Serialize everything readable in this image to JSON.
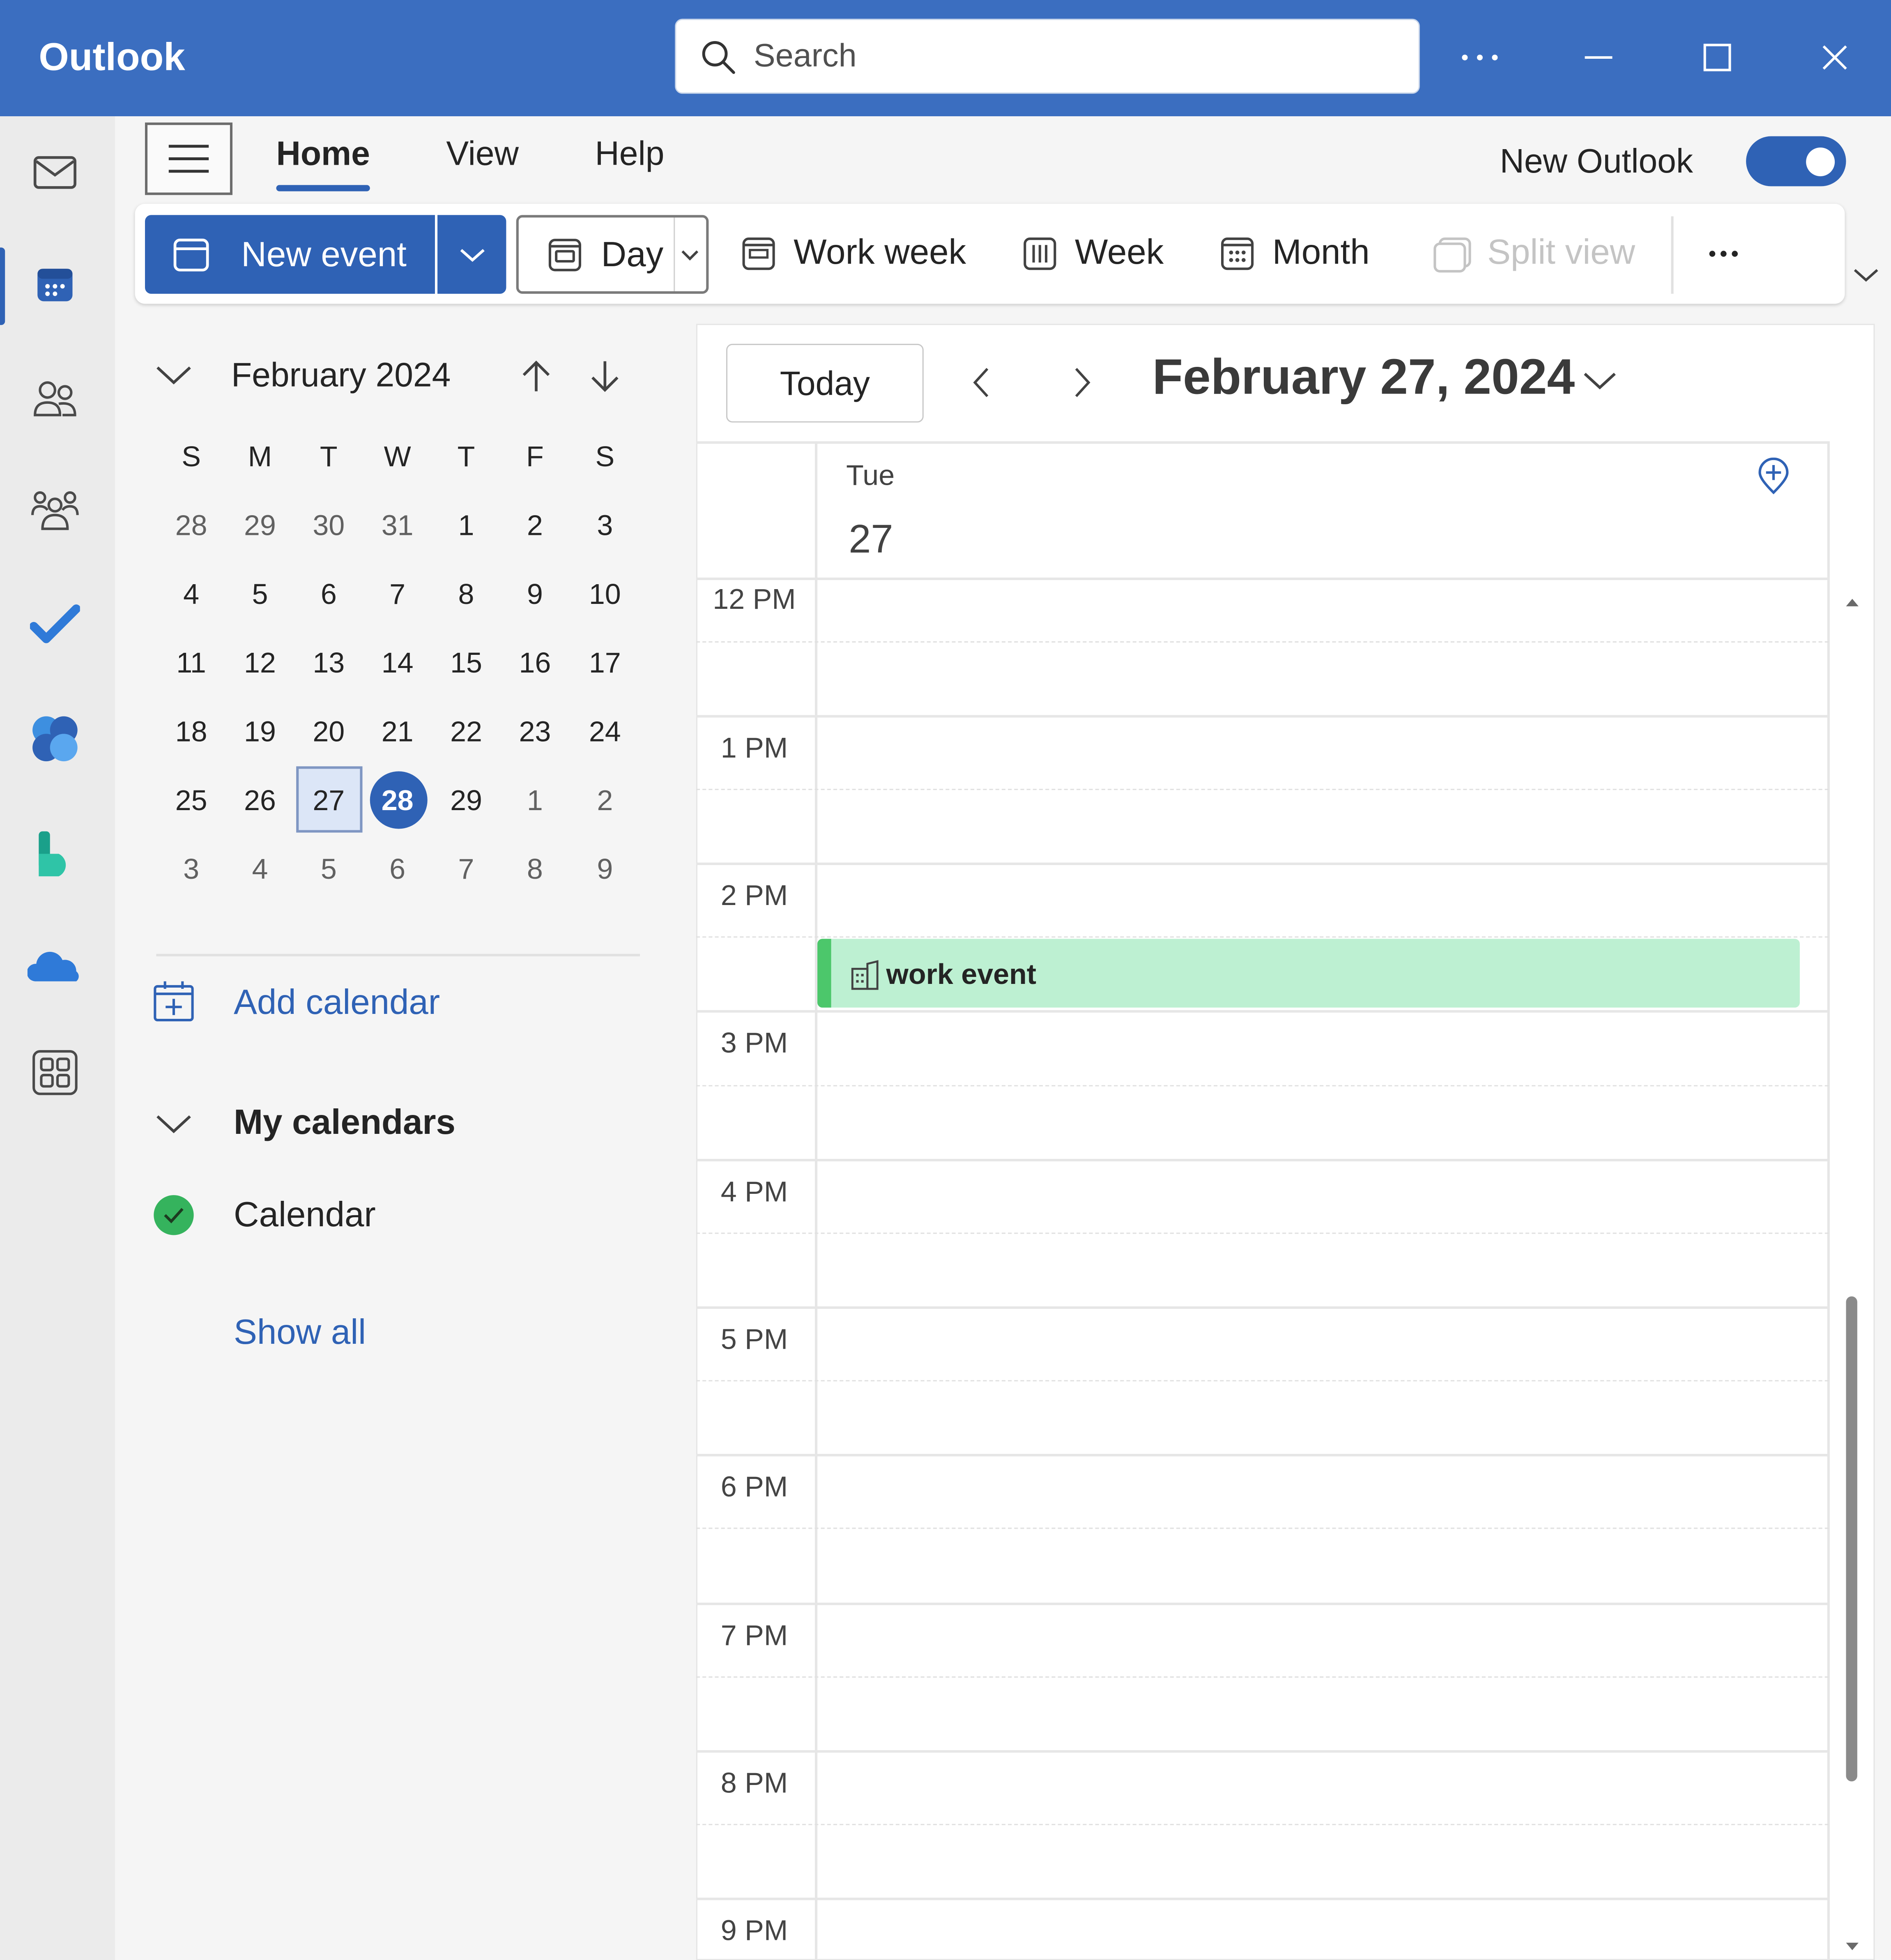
{
  "app": {
    "title": "Outlook"
  },
  "search": {
    "placeholder": "Search"
  },
  "ribbon": {
    "tabs": [
      "Home",
      "View",
      "Help"
    ],
    "toggle_label": "New Outlook"
  },
  "commands": {
    "new_event": "New event",
    "day": "Day",
    "work_week": "Work week",
    "week": "Week",
    "month": "Month",
    "split_view": "Split view"
  },
  "mini_calendar": {
    "title": "February 2024",
    "weekdays": [
      "S",
      "M",
      "T",
      "W",
      "T",
      "F",
      "S"
    ],
    "weeks": [
      [
        "28",
        "29",
        "30",
        "31",
        "1",
        "2",
        "3"
      ],
      [
        "4",
        "5",
        "6",
        "7",
        "8",
        "9",
        "10"
      ],
      [
        "11",
        "12",
        "13",
        "14",
        "15",
        "16",
        "17"
      ],
      [
        "18",
        "19",
        "20",
        "21",
        "22",
        "23",
        "24"
      ],
      [
        "25",
        "26",
        "27",
        "28",
        "29",
        "1",
        "2"
      ],
      [
        "3",
        "4",
        "5",
        "6",
        "7",
        "8",
        "9"
      ]
    ],
    "selected": "27",
    "today": "28"
  },
  "sidebar": {
    "add_calendar": "Add calendar",
    "my_calendars": "My calendars",
    "calendar_item": "Calendar",
    "show_all": "Show all"
  },
  "colors": {
    "accent": "#2f62b5",
    "titlebar": "#3b6ec0",
    "event_fill": "#bdf0d2",
    "event_bar": "#4cc76b"
  },
  "day_view": {
    "today_button": "Today",
    "date_title": "February 27, 2024",
    "day_name": "Tue",
    "day_number": "27",
    "hours": [
      "12 PM",
      "1 PM",
      "2 PM",
      "3 PM",
      "4 PM",
      "5 PM",
      "6 PM",
      "7 PM",
      "8 PM",
      "9 PM"
    ],
    "event": {
      "title": "work event"
    }
  },
  "rail_icons": [
    "mail-icon",
    "calendar-icon",
    "people-icon",
    "groups-icon",
    "todo-icon",
    "copilot-icon",
    "bookings-icon",
    "onedrive-icon",
    "apps-icon"
  ]
}
